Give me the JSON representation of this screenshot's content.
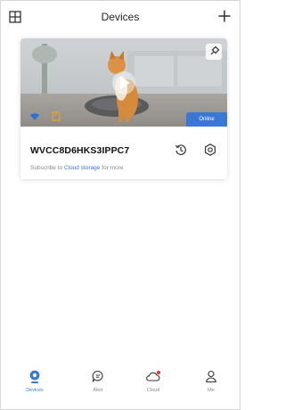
{
  "header": {
    "title": "Devices"
  },
  "device": {
    "name": "WVCC8D6HKS3IPPC7",
    "status": "Online",
    "subtitle_prefix": "Subscribe to ",
    "subtitle_link": "Cloud storage",
    "subtitle_suffix": " for more"
  },
  "nav": {
    "items": [
      {
        "label": "Devices",
        "icon": "camera-icon",
        "active": true
      },
      {
        "label": "Alert",
        "icon": "chat-icon",
        "active": false
      },
      {
        "label": "Cloud",
        "icon": "cloud-icon",
        "active": false,
        "badge": true
      },
      {
        "label": "Me",
        "icon": "person-icon",
        "active": false
      }
    ]
  },
  "colors": {
    "accent": "#3a78d6",
    "badge_dot": "#e53935"
  }
}
